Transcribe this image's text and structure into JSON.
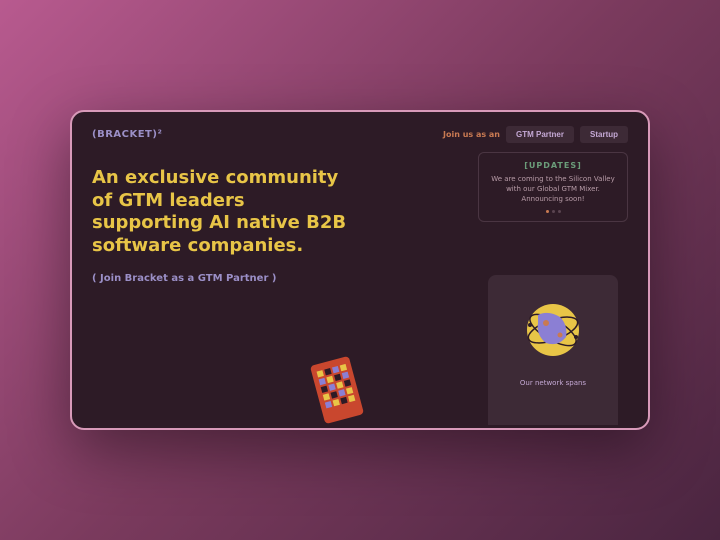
{
  "logo": "(BRACKET)²",
  "nav": {
    "label": "Join us as an",
    "btn1": "GTM Partner",
    "btn2": "Startup"
  },
  "headline": "An exclusive community of GTM leaders supporting AI native B2B software companies.",
  "cta": "( Join Bracket as a GTM Partner )",
  "updates": {
    "title": "[UPDATES]",
    "text": "We are coming to the Silicon Valley with our Global GTM Mixer. Announcing soon!"
  },
  "card_caption": "Our network spans"
}
